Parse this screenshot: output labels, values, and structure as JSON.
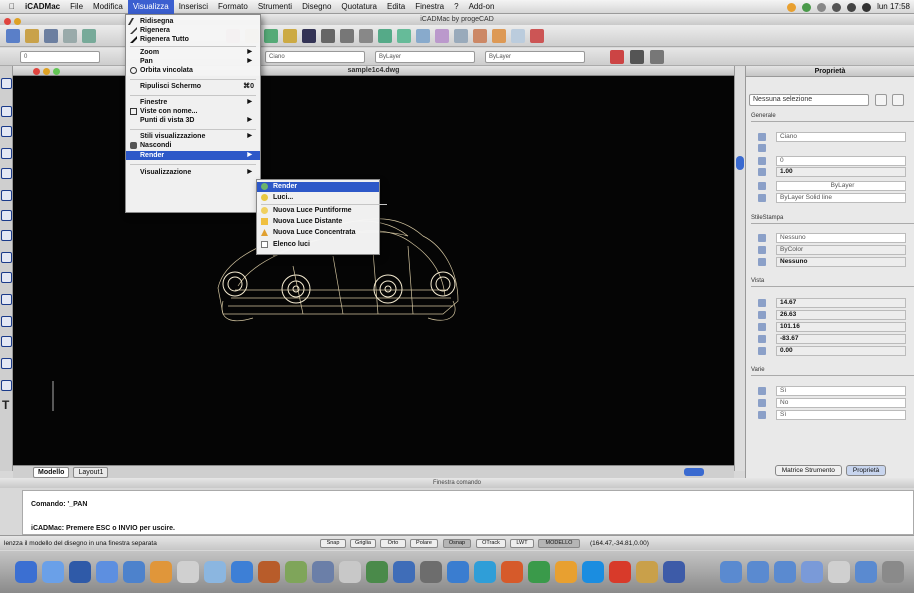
{
  "menubar": {
    "app": "iCADMac",
    "items": [
      "File",
      "Modifica",
      "Visualizza",
      "Inserisci",
      "Formato",
      "Strumenti",
      "Disegno",
      "Quotatura",
      "Edita",
      "Finestra",
      "?",
      "Add-on"
    ],
    "clock": "lun 17:58"
  },
  "window": {
    "title": "iCADMac by progeCAD",
    "drawing_title": "sample1c4.dwg"
  },
  "toolbar2": {
    "layer_value": "0",
    "color_value": "Ciano",
    "linetype_value": "ByLayer",
    "lineweight_value": "Solid line",
    "plotstyle_value": "ByLayer"
  },
  "visualizza_menu": {
    "items": [
      {
        "label": "Ridisegna",
        "arrow": "",
        "shortcut": ""
      },
      {
        "label": "Rigenera",
        "arrow": "",
        "shortcut": ""
      },
      {
        "label": "Rigenera Tutto",
        "arrow": "",
        "shortcut": ""
      },
      {
        "label": "Zoom",
        "arrow": "▶",
        "shortcut": ""
      },
      {
        "label": "Pan",
        "arrow": "▶",
        "shortcut": ""
      },
      {
        "label": "Orbita vincolata",
        "arrow": "",
        "shortcut": ""
      },
      {
        "label": "Ripulisci Schermo",
        "arrow": "",
        "shortcut": "⌘0"
      },
      {
        "label": "Finestre",
        "arrow": "▶",
        "shortcut": ""
      },
      {
        "label": "Viste con nome...",
        "arrow": "",
        "shortcut": ""
      },
      {
        "label": "Punti di vista 3D",
        "arrow": "▶",
        "shortcut": ""
      },
      {
        "label": "Stili visualizzazione",
        "arrow": "▶",
        "shortcut": ""
      },
      {
        "label": "Nascondi",
        "arrow": "",
        "shortcut": ""
      },
      {
        "label": "Render",
        "arrow": "▶",
        "shortcut": ""
      },
      {
        "label": "Visualizzazione",
        "arrow": "▶",
        "shortcut": ""
      }
    ]
  },
  "render_submenu": {
    "items": [
      "Render",
      "Luci...",
      "Nuova Luce Puntiforme",
      "Nuova Luce Distante",
      "Nuova Luce Concentrata",
      "Elenco luci"
    ]
  },
  "layout_tabs": [
    "Modello",
    "Layout1"
  ],
  "command": {
    "window_title": "Finestra comando",
    "line1": "Comando: '_PAN",
    "line2": "iCADMac: Premere ESC o INVIO per uscire."
  },
  "status": {
    "hint": "lenzza il modello del disegno in una finestra separata",
    "buttons": [
      "Snap",
      "Griglia",
      "Orto",
      "Polare",
      "Osnap",
      "OTrack",
      "LWT",
      "MODELLO"
    ],
    "coords": "(164.47,-34.81,0.00)"
  },
  "properties": {
    "title": "Proprietà",
    "selection": "Nessuna selezione",
    "generale": {
      "title": "Generale",
      "color": "Ciano",
      "layer": "0",
      "scale": "1.00",
      "linetype": "ByLayer",
      "lineweight": "ByLayer    Solid line"
    },
    "stile": {
      "title": "StileStampa",
      "v1": "Nessuno",
      "v2": "ByColor",
      "v3": "Nessuno"
    },
    "vista": {
      "title": "Vista",
      "v1": "14.67",
      "v2": "26.63",
      "v3": "101.16",
      "v4": "-83.67",
      "v5": "0.00"
    },
    "varie": {
      "title": "Varie",
      "v1": "Sì",
      "v2": "No",
      "v3": "Sì"
    },
    "footer_tabs": [
      "Matrice Strumento",
      "Proprietà"
    ]
  },
  "colors": {
    "highlight": "#2d58c8",
    "canvas": "#050505",
    "wireframe": "#e9d9b0"
  }
}
